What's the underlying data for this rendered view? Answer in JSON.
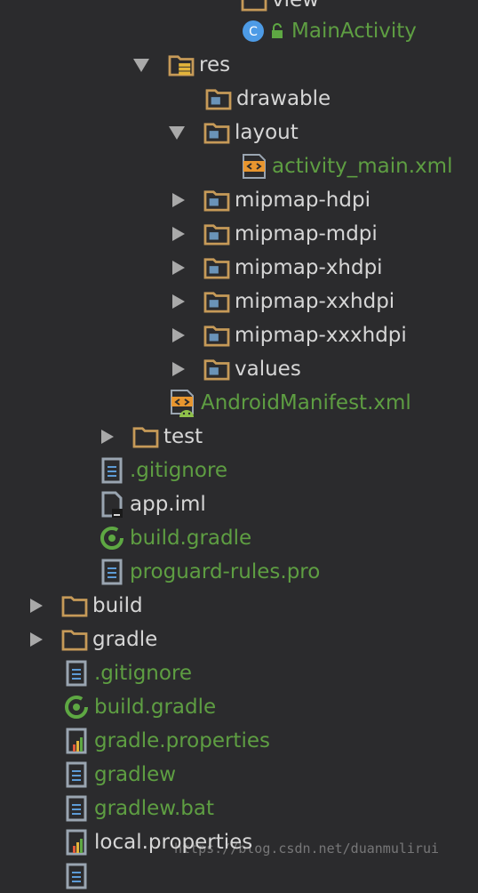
{
  "colors": {
    "background": "#2b2b2d",
    "folder": "#c69a58",
    "changed_file": "#5e9e42",
    "default_text": "#d6d6d6",
    "arrow": "#a9a9a9",
    "class_icon": "#4d9be6"
  },
  "tree": {
    "view": "view",
    "main_activity": "MainActivity",
    "res": "res",
    "drawable": "drawable",
    "layout": "layout",
    "activity_main_xml": "activity_main.xml",
    "mipmap_hdpi": "mipmap-hdpi",
    "mipmap_mdpi": "mipmap-mdpi",
    "mipmap_xhdpi": "mipmap-xhdpi",
    "mipmap_xxhdpi": "mipmap-xxhdpi",
    "mipmap_xxxhdpi": "mipmap-xxxhdpi",
    "values": "values",
    "android_manifest": "AndroidManifest.xml",
    "test": "test",
    "app_gitignore": ".gitignore",
    "app_iml": "app.iml",
    "app_build_gradle": "build.gradle",
    "proguard_rules": "proguard-rules.pro",
    "build": "build",
    "gradle": "gradle",
    "root_gitignore": ".gitignore",
    "root_build_gradle": "build.gradle",
    "gradle_properties": "gradle.properties",
    "gradlew": "gradlew",
    "gradlew_bat": "gradlew.bat",
    "local_properties": "local.properties"
  },
  "watermark": "https://blog.csdn.net/duanmulirui"
}
